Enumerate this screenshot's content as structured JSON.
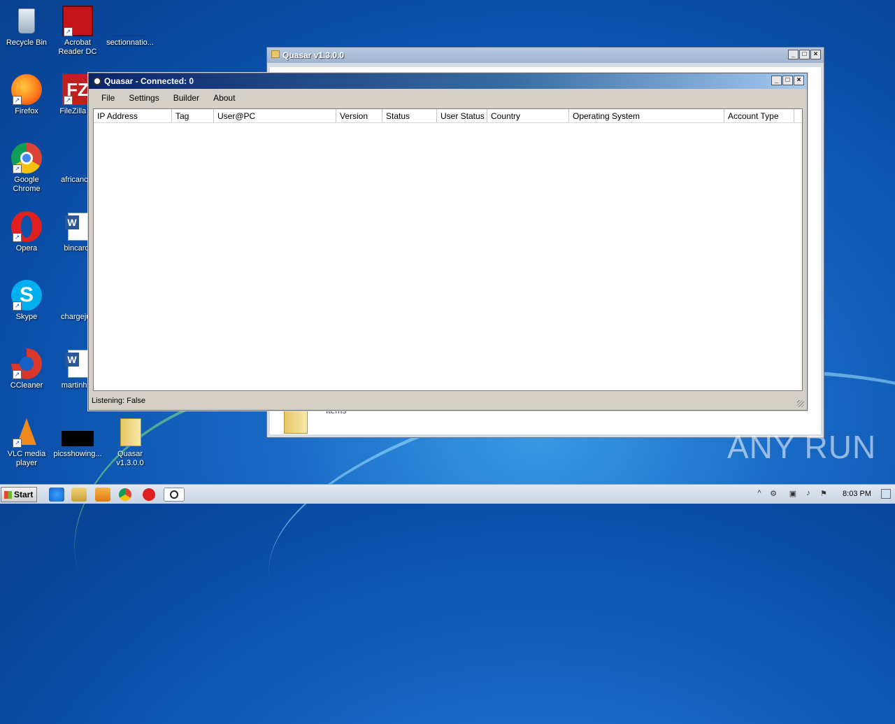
{
  "desktop": {
    "icons": [
      {
        "label": "Recycle Bin"
      },
      {
        "label": "Acrobat Reader DC"
      },
      {
        "label": "sectionnatio..."
      },
      {
        "label": "Firefox"
      },
      {
        "label": "FileZilla Cl"
      },
      {
        "label": "Google Chrome"
      },
      {
        "label": "africancut"
      },
      {
        "label": "Opera"
      },
      {
        "label": "bincard."
      },
      {
        "label": "Skype"
      },
      {
        "label": "chargejus"
      },
      {
        "label": "CCleaner"
      },
      {
        "label": "martinhar"
      },
      {
        "label": "VLC media player"
      },
      {
        "label": "picsshowing..."
      },
      {
        "label": "Quasar v1.3.0.0"
      }
    ]
  },
  "back_window": {
    "title": "Quasar v1.3.0.0",
    "item_text": "Items"
  },
  "main_window": {
    "title": "Quasar - Connected: 0",
    "menu": [
      "File",
      "Settings",
      "Builder",
      "About"
    ],
    "columns": [
      "IP Address",
      "Tag",
      "User@PC",
      "Version",
      "Status",
      "User Status",
      "Country",
      "Operating System",
      "Account Type"
    ],
    "rows": [],
    "status": "Listening: False"
  },
  "taskbar": {
    "start_label": "Start",
    "clock": "8:03 PM"
  },
  "watermark": "ANY RUN",
  "colors": {
    "titlebar_start": "#0a246a",
    "titlebar_end": "#a6caf0",
    "window_face": "#d4d0c8"
  }
}
